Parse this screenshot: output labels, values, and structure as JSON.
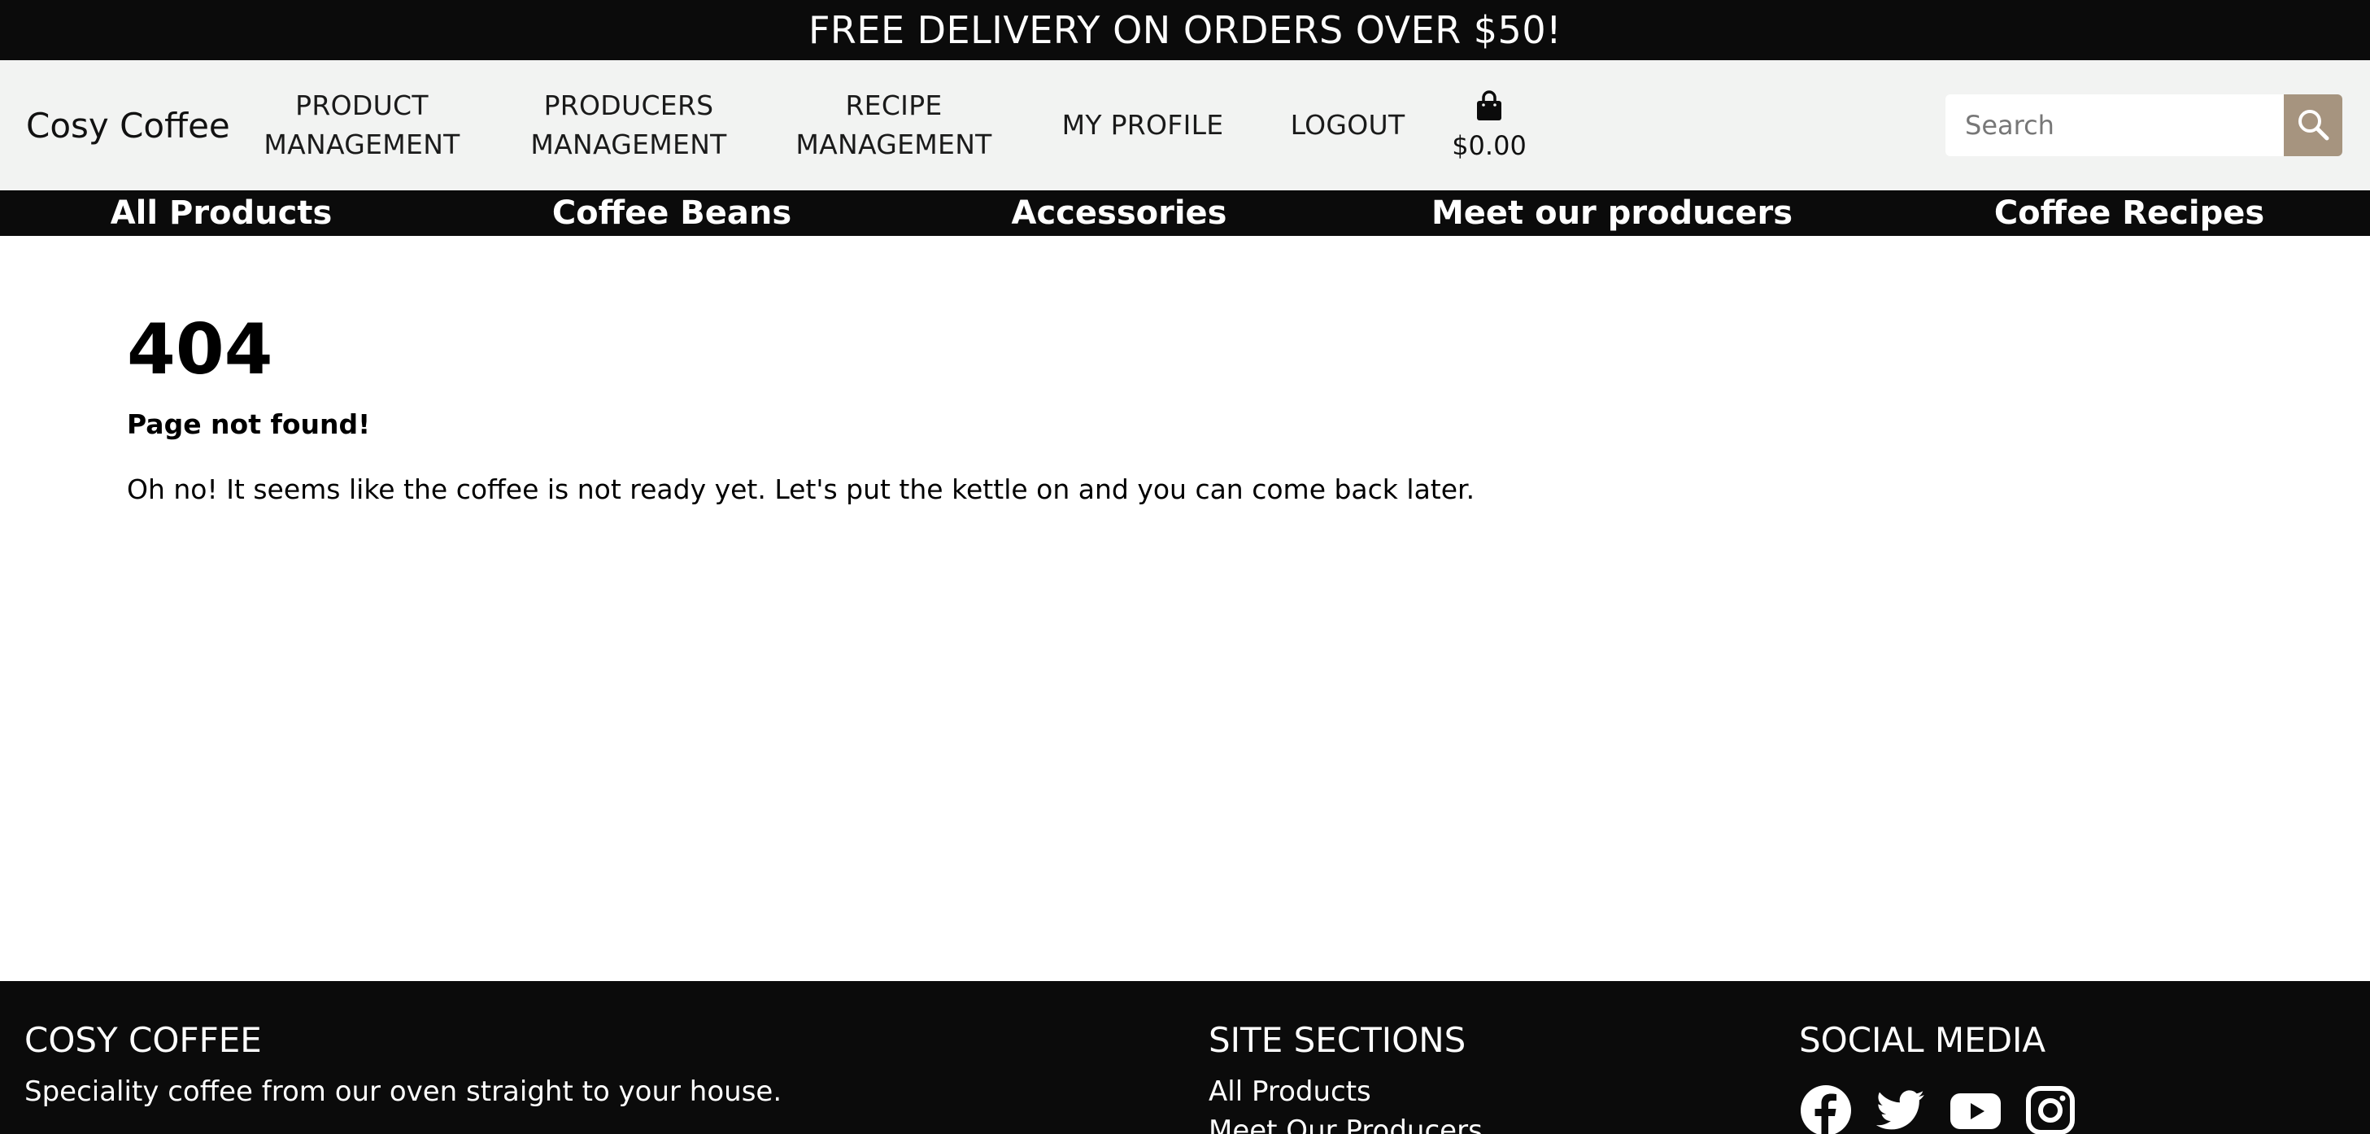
{
  "banner": {
    "text": "FREE DELIVERY ON ORDERS OVER $50!"
  },
  "header": {
    "brand": "Cosy Coffee",
    "nav": [
      {
        "line1": "PRODUCT",
        "line2": "MANAGEMENT"
      },
      {
        "line1": "PRODUCERS",
        "line2": "MANAGEMENT"
      },
      {
        "line1": "RECIPE",
        "line2": "MANAGEMENT"
      },
      {
        "line1": "MY PROFILE"
      },
      {
        "line1": "LOGOUT"
      }
    ],
    "cart": {
      "icon": "shopping-bag-icon",
      "amount": "$0.00"
    },
    "search": {
      "placeholder": "Search",
      "value": "",
      "icon": "search-icon"
    }
  },
  "categories": [
    "All Products",
    "Coffee Beans",
    "Accessories",
    "Meet our producers",
    "Coffee Recipes"
  ],
  "main": {
    "code": "404",
    "subtitle": "Page not found!",
    "message": "Oh no! It seems like the coffee is not ready yet. Let's put the kettle on and you can come back later."
  },
  "footer": {
    "about": {
      "heading": "COSY COFFEE",
      "text": "Speciality coffee from our oven straight to your house."
    },
    "sections": {
      "heading": "SITE SECTIONS",
      "links": [
        "All Products",
        "Meet Our Producers"
      ]
    },
    "social": {
      "heading": "SOCIAL MEDIA",
      "icons": [
        "facebook-icon",
        "twitter-icon",
        "youtube-icon",
        "instagram-icon"
      ]
    }
  },
  "colors": {
    "bar": "#0b0b0b",
    "header_bg": "#f2f3f2",
    "accent": "#a6947f"
  }
}
